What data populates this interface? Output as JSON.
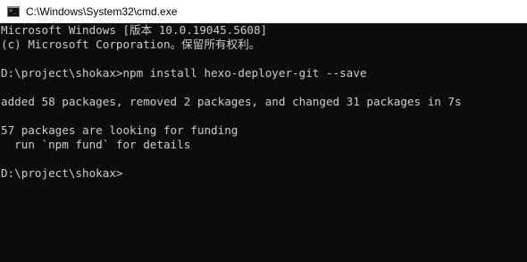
{
  "window": {
    "title": "C:\\Windows\\System32\\cmd.exe",
    "icon": "cmd-icon",
    "colors": {
      "background": "#0c0c0c",
      "foreground": "#cccccc",
      "titlebar": "#ffffff"
    }
  },
  "console": {
    "lines": [
      "Microsoft Windows [版本 10.0.19045.5608]",
      "(c) Microsoft Corporation。保留所有权利。",
      "",
      "D:\\project\\shokax>npm install hexo-deployer-git --save",
      "",
      "added 58 packages, removed 2 packages, and changed 31 packages in 7s",
      "",
      "57 packages are looking for funding",
      "  run `npm fund` for details",
      "",
      "D:\\project\\shokax>"
    ]
  }
}
